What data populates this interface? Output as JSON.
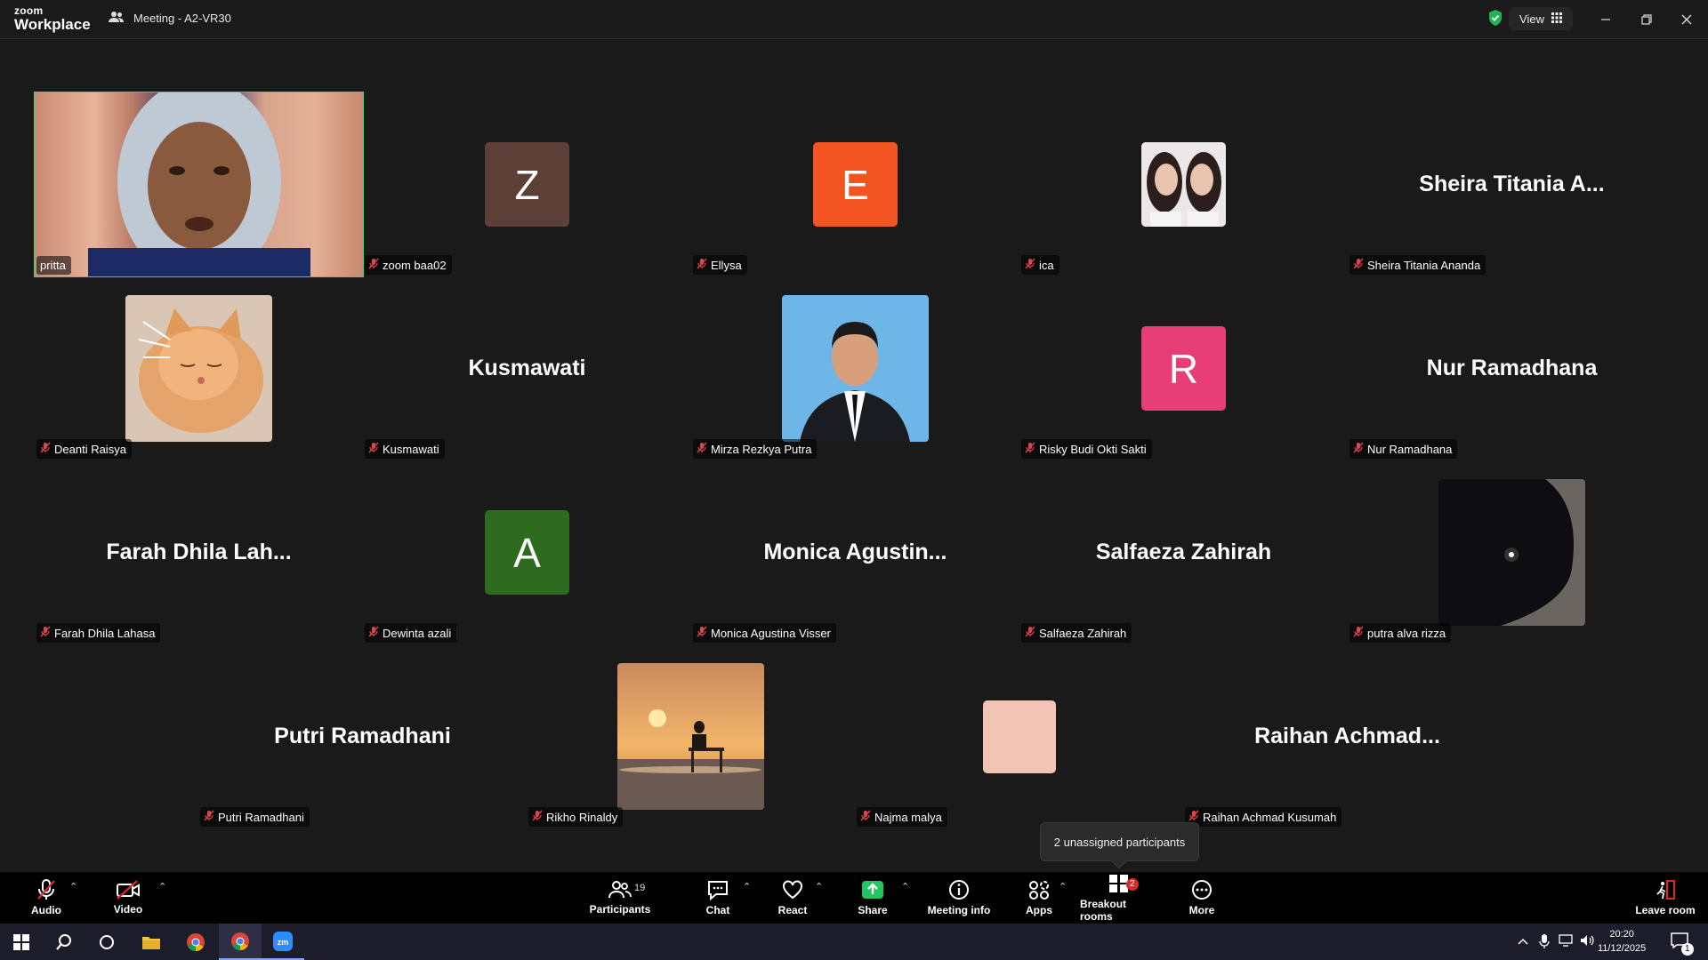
{
  "app": {
    "logo_top": "zoom",
    "logo_bottom": "Workplace",
    "meeting_title": "Meeting - A2-VR30",
    "view_label": "View"
  },
  "tiles": [
    {
      "name": "pritta",
      "kind": "video",
      "muted": false
    },
    {
      "name": "zoom baa02",
      "kind": "avatar",
      "letter": "Z",
      "color": "#5c4037",
      "muted": true
    },
    {
      "name": "Ellysa",
      "kind": "avatar",
      "letter": "E",
      "color": "#f25522",
      "muted": true
    },
    {
      "name": "ica",
      "kind": "photo",
      "muted": true
    },
    {
      "name": "Sheira Titania Ananda",
      "kind": "bigname",
      "display": "Sheira Titania A...",
      "muted": true
    },
    {
      "name": "Deanti Raisya",
      "kind": "photo",
      "muted": true
    },
    {
      "name": "Kusmawati",
      "kind": "bigname",
      "display": "Kusmawati",
      "muted": true
    },
    {
      "name": "Mirza Rezkya Putra",
      "kind": "photo",
      "muted": true
    },
    {
      "name": "Risky Budi Okti Sakti",
      "kind": "avatar",
      "letter": "R",
      "color": "#e83e78",
      "muted": true
    },
    {
      "name": "Nur Ramadhana",
      "kind": "bigname",
      "display": "Nur Ramadhana",
      "muted": true
    },
    {
      "name": "Farah Dhila Lahasa",
      "kind": "bigname",
      "display": "Farah Dhila Lah...",
      "muted": true
    },
    {
      "name": "Dewinta azali",
      "kind": "avatar",
      "letter": "A",
      "color": "#2e6b1e",
      "muted": true
    },
    {
      "name": "Monica Agustina Visser",
      "kind": "bigname",
      "display": "Monica  Agustin...",
      "muted": true
    },
    {
      "name": "Salfaeza Zahirah",
      "kind": "bigname",
      "display": "Salfaeza Zahirah",
      "muted": true
    },
    {
      "name": "putra alva rizza",
      "kind": "photo",
      "muted": true
    },
    {
      "name": "Putri Ramadhani",
      "kind": "bigname",
      "display": "Putri Ramadhani",
      "muted": true
    },
    {
      "name": "Rikho Rinaldy",
      "kind": "photo",
      "muted": true
    },
    {
      "name": "Najma malya",
      "kind": "avatar",
      "letter": "",
      "color": "#f2c4b6",
      "muted": true
    },
    {
      "name": "Raihan Achmad Kusumah",
      "kind": "bigname",
      "display": "Raihan  Achmad...",
      "muted": true
    }
  ],
  "tooltip": "2 unassigned participants",
  "toolbar": {
    "audio": "Audio",
    "video": "Video",
    "participants": "Participants",
    "participants_count": "19",
    "chat": "Chat",
    "react": "React",
    "share": "Share",
    "meeting_info": "Meeting info",
    "apps": "Apps",
    "breakout": "Breakout rooms",
    "breakout_badge": "2",
    "more": "More",
    "leave": "Leave room"
  },
  "taskbar": {
    "time": "20:20",
    "date": "11/12/2025",
    "notif_count": "1"
  },
  "colors": {
    "active_border": "#2bdc7c",
    "share_green": "#22c55e",
    "leave_red": "#e02828"
  }
}
